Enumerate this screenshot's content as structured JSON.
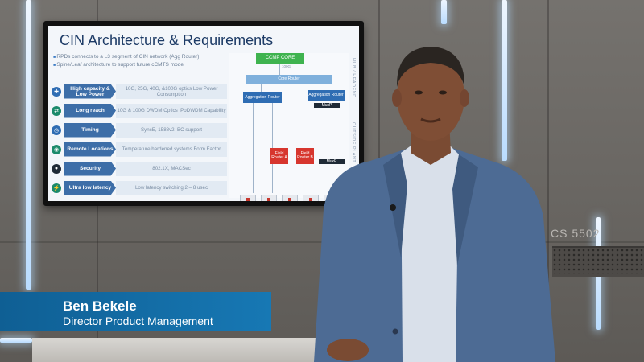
{
  "slide": {
    "title": "CIN Architecture & Requirements",
    "bullets": [
      "RPDs connects to a L3 segment of CIN network (Agg Router)",
      "Spine/Leaf architecture to support future cCMTS model"
    ],
    "requirements": [
      {
        "label": "High capacity & Low Power",
        "desc": "10G, 25G, 40G, &100G optics Low Power Consumption",
        "icon": "capacity-icon",
        "color": "#2f6db3"
      },
      {
        "label": "Long reach",
        "desc": "10G & 100G DWDM Optics IPoDWDM Capability",
        "icon": "reach-icon",
        "color": "#1b8a6b"
      },
      {
        "label": "Timing",
        "desc": "SyncE, 1588v2, BC support",
        "icon": "timing-icon",
        "color": "#2f6db3"
      },
      {
        "label": "Remote Locations",
        "desc": "Temperature hardened systems Form Factor",
        "icon": "location-icon",
        "color": "#1b8a6b"
      },
      {
        "label": "Security",
        "desc": "802.1X, MACSec",
        "icon": "security-icon",
        "color": "#1f2a36"
      },
      {
        "label": "Ultra low latency",
        "desc": "Low latency switching 2 – 8 usec",
        "icon": "latency-icon",
        "color": "#1b8a6b"
      }
    ],
    "diagram": {
      "cmts_core": "CCMP CORE",
      "core_router": "Core Router",
      "link_speed": "100G",
      "agg_router_left": "Aggregation Router",
      "agg_router_right": "Aggregation Router",
      "muxp_top": "MuxP",
      "muxp_bottom": "MuxP",
      "field_router_a": "Field Router A",
      "field_router_b": "Field Router B",
      "side_top": "HUB / HEADEND",
      "side_bottom": "OUTSIDE PLANT"
    }
  },
  "background": {
    "device_label": "CS 5502"
  },
  "lower_third": {
    "name": "Ben Bekele",
    "title": "Director Product Management"
  }
}
